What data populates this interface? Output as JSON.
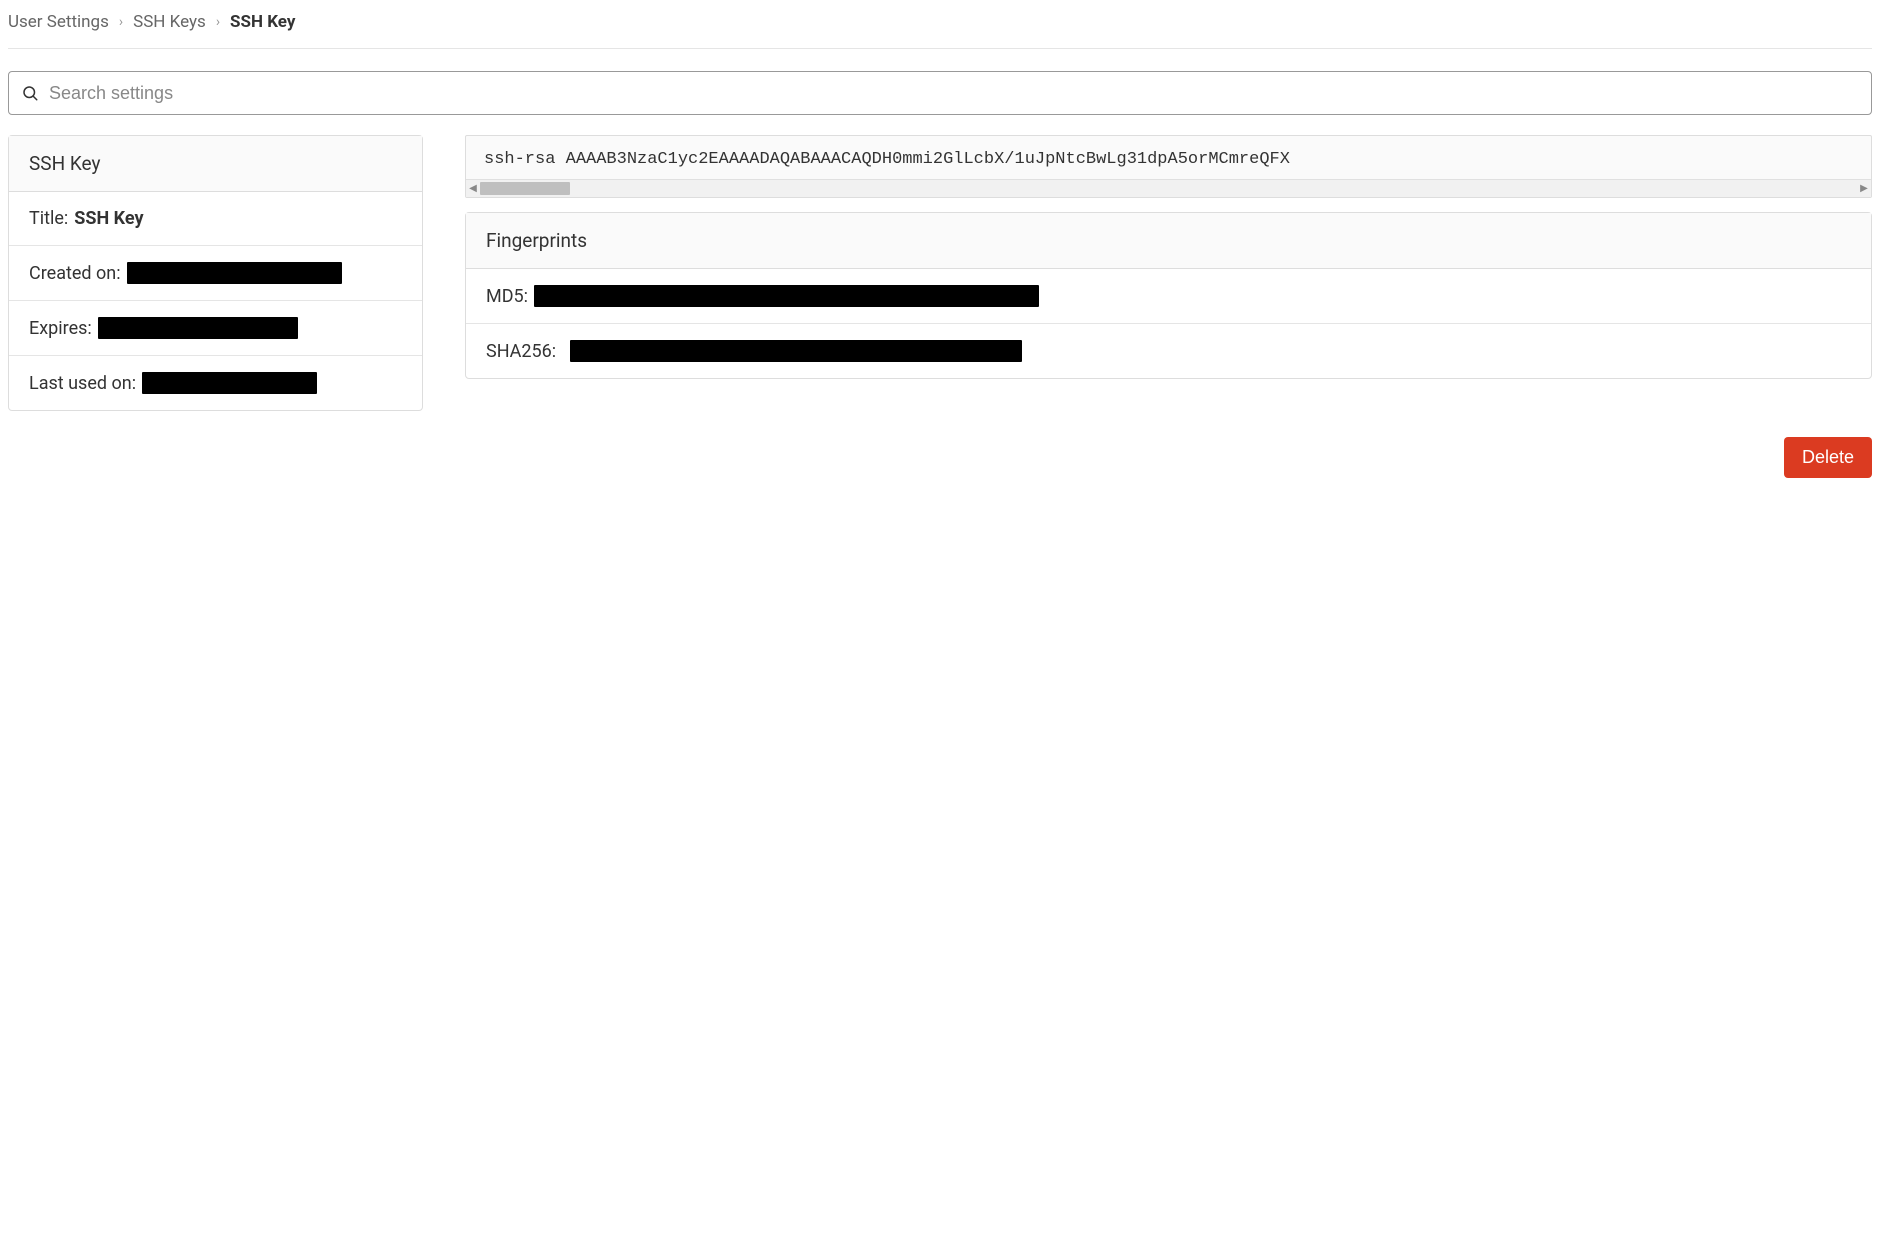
{
  "breadcrumb": {
    "items": [
      {
        "label": "User Settings"
      },
      {
        "label": "SSH Keys"
      },
      {
        "label": "SSH Key"
      }
    ],
    "separator": "›"
  },
  "search": {
    "placeholder": "Search settings"
  },
  "details_card": {
    "header": "SSH Key",
    "title_label": "Title: ",
    "title_value": "SSH Key",
    "created_on_label": "Created on: ",
    "created_on_value": "",
    "expires_label": "Expires: ",
    "expires_value": "",
    "last_used_label": "Last used on: ",
    "last_used_value": ""
  },
  "key": {
    "text": "ssh-rsa AAAAB3NzaC1yc2EAAAADAQABAAACAQDH0mmi2GlLcbX/1uJpNtcBwLg31dpA5orMCmreQFX"
  },
  "fingerprints": {
    "header": "Fingerprints",
    "md5_label": "MD5: ",
    "md5_value": "",
    "sha256_label": "SHA256: ",
    "sha256_value": ""
  },
  "actions": {
    "delete_label": "Delete"
  },
  "colors": {
    "danger": "#db3b21",
    "border": "#dddddd",
    "muted_bg": "#fafafa"
  }
}
